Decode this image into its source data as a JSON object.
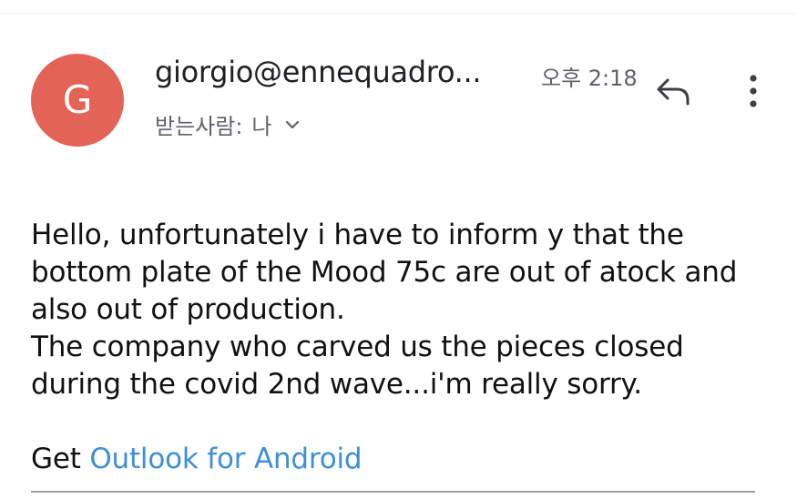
{
  "header": {
    "avatar_letter": "G",
    "avatar_color": "#e36456",
    "sender": "giorgio@ennequadro...",
    "time": "오후 2:18",
    "recipient_label": "받는사람:",
    "recipient_value": "나",
    "icons": {
      "expand": "chevron-down-icon",
      "reply": "reply-icon",
      "more": "more-vert-icon"
    }
  },
  "message": {
    "lines": [
      "Hello, unfortunately i have to inform y that the bottom plate of the Mood 75c are out of atock and also out of production.",
      "The company who carved us the pieces closed during the covid 2nd wave...i'm really sorry."
    ],
    "signature_prefix": "Get",
    "signature_link": "Outlook for Android",
    "link_color": "#3f8fd6"
  }
}
